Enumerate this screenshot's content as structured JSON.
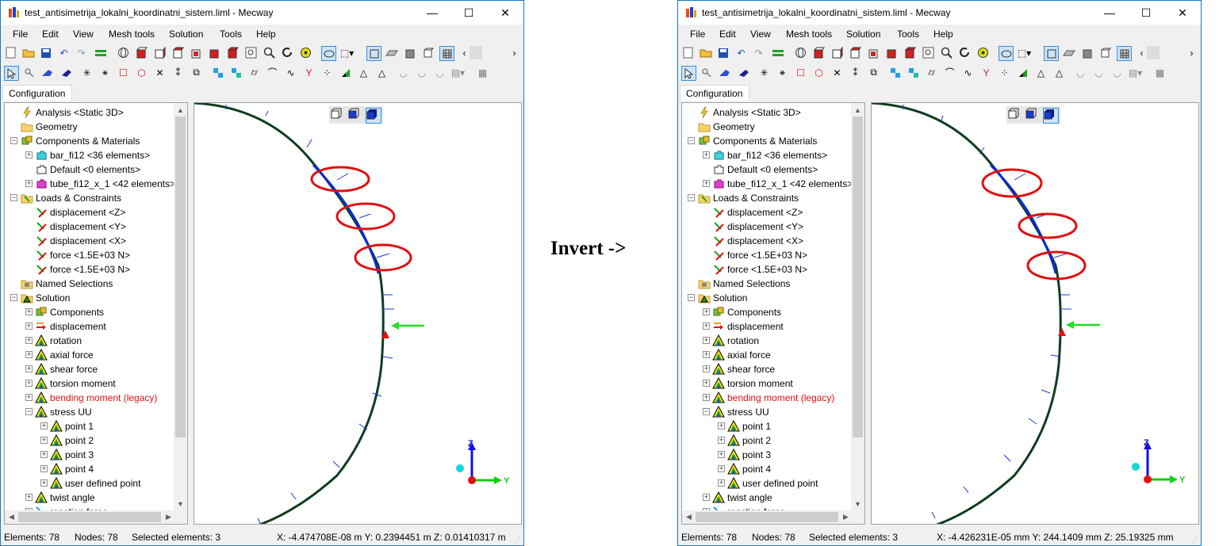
{
  "middle_label": "Invert ->",
  "colors": {
    "beam_dark": "#0f3d1e",
    "beam_selected": "#0a2ad8",
    "highlight_circle": "#e01010",
    "axis_z": "#1010e0",
    "axis_y": "#10d010",
    "origin": "#e01010",
    "arrow": "#22dd22",
    "constraint": "#e01010"
  },
  "windows": [
    {
      "title": "test_antisimetrija_lokalni_koordinatni_sistem.liml - Mecway",
      "window_buttons": {
        "minimize": "—",
        "maximize": "☐",
        "close": "✕"
      },
      "menu": [
        "File",
        "Edit",
        "View",
        "Mesh tools",
        "Solution",
        "Tools",
        "Help"
      ],
      "tab": "Configuration",
      "tree": [
        {
          "label": "Analysis <Static 3D>",
          "icon": "analysis-icon",
          "level": 1,
          "expander": ""
        },
        {
          "label": "Geometry",
          "icon": "folder-icon",
          "level": 1,
          "expander": ""
        },
        {
          "label": "Components & Materials",
          "icon": "components-icon",
          "level": 1,
          "expander": "−"
        },
        {
          "label": "bar_fi12 <36 elements>",
          "icon": "component-cyan-icon",
          "level": 2,
          "expander": "+"
        },
        {
          "label": "Default <0 elements>",
          "icon": "component-empty-icon",
          "level": 2,
          "expander": ""
        },
        {
          "label": "tube_fi12_x_1 <42 elements>",
          "icon": "component-magenta-icon",
          "level": 2,
          "expander": "+"
        },
        {
          "label": "Loads & Constraints",
          "icon": "loads-icon",
          "level": 1,
          "expander": "−"
        },
        {
          "label": "displacement <Z>",
          "icon": "displacement-icon",
          "level": 2,
          "expander": ""
        },
        {
          "label": "displacement <Y>",
          "icon": "displacement-icon",
          "level": 2,
          "expander": ""
        },
        {
          "label": "displacement <X>",
          "icon": "displacement-icon",
          "level": 2,
          "expander": ""
        },
        {
          "label": "force <1.5E+03 N>",
          "icon": "force-icon",
          "level": 2,
          "expander": ""
        },
        {
          "label": "force <1.5E+03 N>",
          "icon": "force-icon",
          "level": 2,
          "expander": ""
        },
        {
          "label": "Named Selections",
          "icon": "named-selections-icon",
          "level": 1,
          "expander": ""
        },
        {
          "label": "Solution",
          "icon": "solution-icon",
          "level": 1,
          "expander": "−"
        },
        {
          "label": "Components",
          "icon": "components-icon",
          "level": 2,
          "expander": "+"
        },
        {
          "label": "displacement",
          "icon": "result-displacement-icon",
          "level": 2,
          "expander": "+"
        },
        {
          "label": "rotation",
          "icon": "result-icon",
          "level": 2,
          "expander": "+"
        },
        {
          "label": "axial force",
          "icon": "result-icon",
          "level": 2,
          "expander": "+"
        },
        {
          "label": "shear force",
          "icon": "result-icon",
          "level": 2,
          "expander": "+"
        },
        {
          "label": "torsion moment",
          "icon": "result-icon",
          "level": 2,
          "expander": "+"
        },
        {
          "label": "bending moment (legacy)",
          "icon": "result-icon",
          "level": 2,
          "expander": "+",
          "red": true
        },
        {
          "label": "stress UU",
          "icon": "result-icon",
          "level": 2,
          "expander": "−"
        },
        {
          "label": "point 1",
          "icon": "result-icon",
          "level": 3,
          "expander": "+"
        },
        {
          "label": "point 2",
          "icon": "result-icon",
          "level": 3,
          "expander": "+"
        },
        {
          "label": "point 3",
          "icon": "result-icon",
          "level": 3,
          "expander": "+"
        },
        {
          "label": "point 4",
          "icon": "result-icon",
          "level": 3,
          "expander": "+"
        },
        {
          "label": "user defined point",
          "icon": "result-icon",
          "level": 3,
          "expander": "+"
        },
        {
          "label": "twist angle",
          "icon": "result-icon",
          "level": 2,
          "expander": "+"
        },
        {
          "label": "reaction force",
          "icon": "reaction-icon",
          "level": 2,
          "expander": "+"
        }
      ],
      "axis_labels": {
        "z": "Z",
        "y": "Y"
      },
      "status": {
        "elements": "Elements: 78",
        "nodes": "Nodes: 78",
        "selected": "Selected elements: 3",
        "coords": "X: -4.474708E-08 m Y: 0.2394451 m Z: 0.01410317 m"
      }
    },
    {
      "title": "test_antisimetrija_lokalni_koordinatni_sistem.liml - Mecway",
      "window_buttons": {
        "minimize": "—",
        "maximize": "☐",
        "close": "✕"
      },
      "menu": [
        "File",
        "Edit",
        "View",
        "Mesh tools",
        "Solution",
        "Tools",
        "Help"
      ],
      "tab": "Configuration",
      "tree": [
        {
          "label": "Analysis <Static 3D>",
          "icon": "analysis-icon",
          "level": 1,
          "expander": ""
        },
        {
          "label": "Geometry",
          "icon": "folder-icon",
          "level": 1,
          "expander": ""
        },
        {
          "label": "Components & Materials",
          "icon": "components-icon",
          "level": 1,
          "expander": "−"
        },
        {
          "label": "bar_fi12 <36 elements>",
          "icon": "component-cyan-icon",
          "level": 2,
          "expander": "+"
        },
        {
          "label": "Default <0 elements>",
          "icon": "component-empty-icon",
          "level": 2,
          "expander": ""
        },
        {
          "label": "tube_fi12_x_1 <42 elements>",
          "icon": "component-magenta-icon",
          "level": 2,
          "expander": "+"
        },
        {
          "label": "Loads & Constraints",
          "icon": "loads-icon",
          "level": 1,
          "expander": "−"
        },
        {
          "label": "displacement <Z>",
          "icon": "displacement-icon",
          "level": 2,
          "expander": ""
        },
        {
          "label": "displacement <Y>",
          "icon": "displacement-icon",
          "level": 2,
          "expander": ""
        },
        {
          "label": "displacement <X>",
          "icon": "displacement-icon",
          "level": 2,
          "expander": ""
        },
        {
          "label": "force <1.5E+03 N>",
          "icon": "force-icon",
          "level": 2,
          "expander": ""
        },
        {
          "label": "force <1.5E+03 N>",
          "icon": "force-icon",
          "level": 2,
          "expander": ""
        },
        {
          "label": "Named Selections",
          "icon": "named-selections-icon",
          "level": 1,
          "expander": ""
        },
        {
          "label": "Solution",
          "icon": "solution-icon",
          "level": 1,
          "expander": "−"
        },
        {
          "label": "Components",
          "icon": "components-icon",
          "level": 2,
          "expander": "+"
        },
        {
          "label": "displacement",
          "icon": "result-displacement-icon",
          "level": 2,
          "expander": "+"
        },
        {
          "label": "rotation",
          "icon": "result-icon",
          "level": 2,
          "expander": "+"
        },
        {
          "label": "axial force",
          "icon": "result-icon",
          "level": 2,
          "expander": "+"
        },
        {
          "label": "shear force",
          "icon": "result-icon",
          "level": 2,
          "expander": "+"
        },
        {
          "label": "torsion moment",
          "icon": "result-icon",
          "level": 2,
          "expander": "+"
        },
        {
          "label": "bending moment (legacy)",
          "icon": "result-icon",
          "level": 2,
          "expander": "+",
          "red": true
        },
        {
          "label": "stress UU",
          "icon": "result-icon",
          "level": 2,
          "expander": "−"
        },
        {
          "label": "point 1",
          "icon": "result-icon",
          "level": 3,
          "expander": "+"
        },
        {
          "label": "point 2",
          "icon": "result-icon",
          "level": 3,
          "expander": "+"
        },
        {
          "label": "point 3",
          "icon": "result-icon",
          "level": 3,
          "expander": "+"
        },
        {
          "label": "point 4",
          "icon": "result-icon",
          "level": 3,
          "expander": "+"
        },
        {
          "label": "user defined point",
          "icon": "result-icon",
          "level": 3,
          "expander": "+"
        },
        {
          "label": "twist angle",
          "icon": "result-icon",
          "level": 2,
          "expander": "+"
        },
        {
          "label": "reaction force",
          "icon": "reaction-icon",
          "level": 2,
          "expander": "+"
        }
      ],
      "axis_labels": {
        "z": "Z",
        "y": "Y"
      },
      "status": {
        "elements": "Elements: 78",
        "nodes": "Nodes: 78",
        "selected": "Selected elements: 3",
        "coords": "X: -4.426231E-05 mm Y: 244.1409 mm Z: 25.19325 mm"
      }
    }
  ]
}
